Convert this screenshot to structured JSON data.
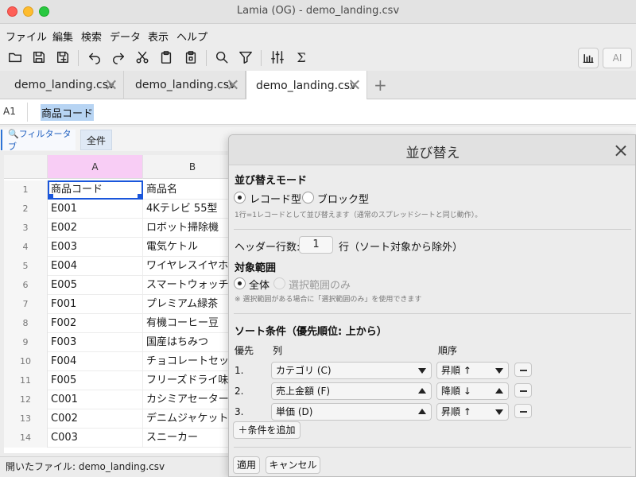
{
  "window": {
    "title": "Lamia (OG) - demo_landing.csv"
  },
  "menu": {
    "items": [
      "ファイル",
      "編集",
      "検索",
      "データ",
      "表示",
      "ヘルプ"
    ]
  },
  "toolbar": {
    "icons": [
      "folder-open-icon",
      "save-icon",
      "save-as-icon",
      "undo-icon",
      "redo-icon",
      "cut-icon",
      "paste-icon",
      "copy-icon",
      "search-icon",
      "filter-icon",
      "adjust-icon",
      "sum-icon"
    ],
    "sigma_glyph": "Σ",
    "ai_label": "AI"
  },
  "tabs": {
    "items": [
      "demo_landing.csv",
      "demo_landing.csv",
      "demo_landing.csv"
    ],
    "active_index": 2,
    "add_glyph": "+"
  },
  "formula": {
    "cell_ref": "A1",
    "value": "商品コード"
  },
  "filter": {
    "tab_label": "🔍フィルタータブ",
    "all_label": "全件"
  },
  "grid": {
    "columns": [
      "A",
      "B"
    ],
    "rows": [
      {
        "n": "1",
        "a": "商品コード",
        "b": "商品名"
      },
      {
        "n": "2",
        "a": "E001",
        "b": "4Kテレビ 55型"
      },
      {
        "n": "3",
        "a": "E002",
        "b": "ロボット掃除機"
      },
      {
        "n": "4",
        "a": "E003",
        "b": "電気ケトル"
      },
      {
        "n": "5",
        "a": "E004",
        "b": "ワイヤレスイヤホ"
      },
      {
        "n": "6",
        "a": "E005",
        "b": "スマートウォッチ"
      },
      {
        "n": "7",
        "a": "F001",
        "b": "プレミアム緑茶"
      },
      {
        "n": "8",
        "a": "F002",
        "b": "有機コーヒー豆"
      },
      {
        "n": "9",
        "a": "F003",
        "b": "国産はちみつ"
      },
      {
        "n": "10",
        "a": "F004",
        "b": "チョコレートセッ"
      },
      {
        "n": "11",
        "a": "F005",
        "b": "フリーズドライ味"
      },
      {
        "n": "12",
        "a": "C001",
        "b": "カシミアセーター"
      },
      {
        "n": "13",
        "a": "C002",
        "b": "デニムジャケット"
      },
      {
        "n": "14",
        "a": "C003",
        "b": "スニーカー"
      }
    ]
  },
  "status": {
    "text": "開いたファイル: demo_landing.csv"
  },
  "sort_dialog": {
    "title": "並び替え",
    "mode_label": "並び替えモード",
    "mode_options": [
      "レコード型",
      "ブロック型"
    ],
    "mode_selected": "レコード型",
    "mode_note": "1行=1レコードとして並び替えます（通常のスプレッドシートと同じ動作）。",
    "header_label": "ヘッダー行数:",
    "header_value": "1",
    "header_suffix": "行（ソート対象から除外）",
    "range_label": "対象範囲",
    "range_options": [
      "全体",
      "選択範囲のみ"
    ],
    "range_selected": "全体",
    "range_note": "※ 選択範囲がある場合に「選択範囲のみ」を使用できます",
    "conditions_label": "ソート条件（優先順位: 上から）",
    "col_headers": {
      "priority": "優先",
      "column": "列",
      "order": "順序"
    },
    "conditions": [
      {
        "priority": "1.",
        "column": "カテゴリ (C)",
        "order": "昇順 ↑"
      },
      {
        "priority": "2.",
        "column": "売上金額 (F)",
        "order": "降順 ↓"
      },
      {
        "priority": "3.",
        "column": "単価 (D)",
        "order": "昇順 ↑"
      }
    ],
    "add_condition": "＋条件を追加",
    "apply": "適用",
    "cancel": "キャンセル"
  }
}
